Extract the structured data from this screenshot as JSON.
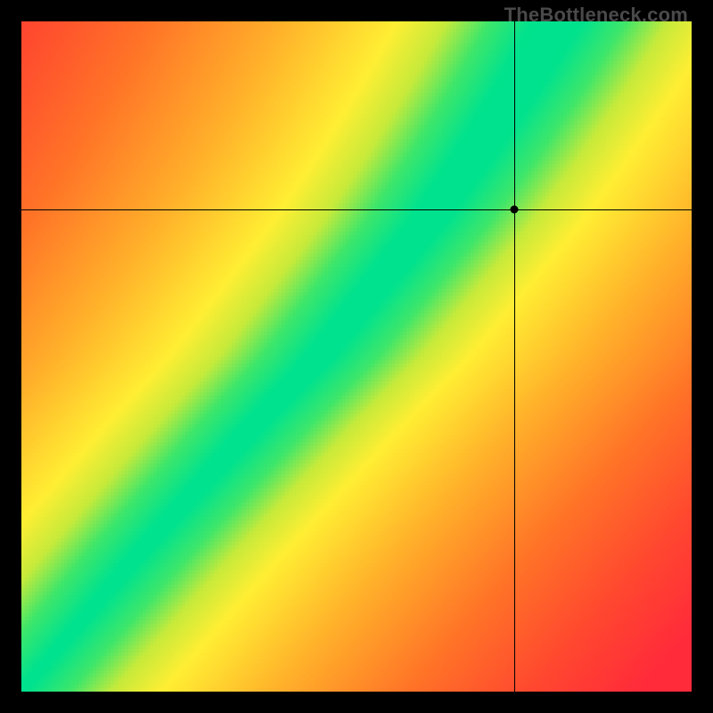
{
  "watermark": "TheBottleneck.com",
  "chart_data": {
    "type": "heatmap",
    "title": "",
    "xlabel": "",
    "ylabel": "",
    "xlim": [
      0,
      1
    ],
    "ylim": [
      0,
      1
    ],
    "grid": false,
    "legend": false,
    "crosshair": {
      "x": 0.735,
      "y": 0.72
    },
    "marker": {
      "x": 0.735,
      "y": 0.72
    },
    "optimal_curve_description": "Green band runs from bottom-left (0,0) upward; at y≈0.5 it sits near x≈0.45; band curves and steepens, passing near x≈0.62 at y≈0.72, reaching x≈0.8 at y≈1.0. Colors grade yellow→orange→red with distance from the band; top-left and bottom-right corners are deepest red.",
    "optimal_curve_points": [
      {
        "y": 0.0,
        "x": 0.0
      },
      {
        "y": 0.1,
        "x": 0.085
      },
      {
        "y": 0.2,
        "x": 0.17
      },
      {
        "y": 0.3,
        "x": 0.26
      },
      {
        "y": 0.4,
        "x": 0.35
      },
      {
        "y": 0.5,
        "x": 0.445
      },
      {
        "y": 0.6,
        "x": 0.525
      },
      {
        "y": 0.7,
        "x": 0.605
      },
      {
        "y": 0.8,
        "x": 0.675
      },
      {
        "y": 0.9,
        "x": 0.74
      },
      {
        "y": 1.0,
        "x": 0.8
      }
    ],
    "band_halfwidth": 0.05,
    "color_stops": [
      {
        "t": 0.0,
        "color": "#00e28e"
      },
      {
        "t": 0.07,
        "color": "#3ee66a"
      },
      {
        "t": 0.14,
        "color": "#c7ea3a"
      },
      {
        "t": 0.22,
        "color": "#ffee33"
      },
      {
        "t": 0.4,
        "color": "#ffb22a"
      },
      {
        "t": 0.62,
        "color": "#ff7327"
      },
      {
        "t": 0.82,
        "color": "#ff472f"
      },
      {
        "t": 1.0,
        "color": "#ff2a3a"
      }
    ]
  }
}
